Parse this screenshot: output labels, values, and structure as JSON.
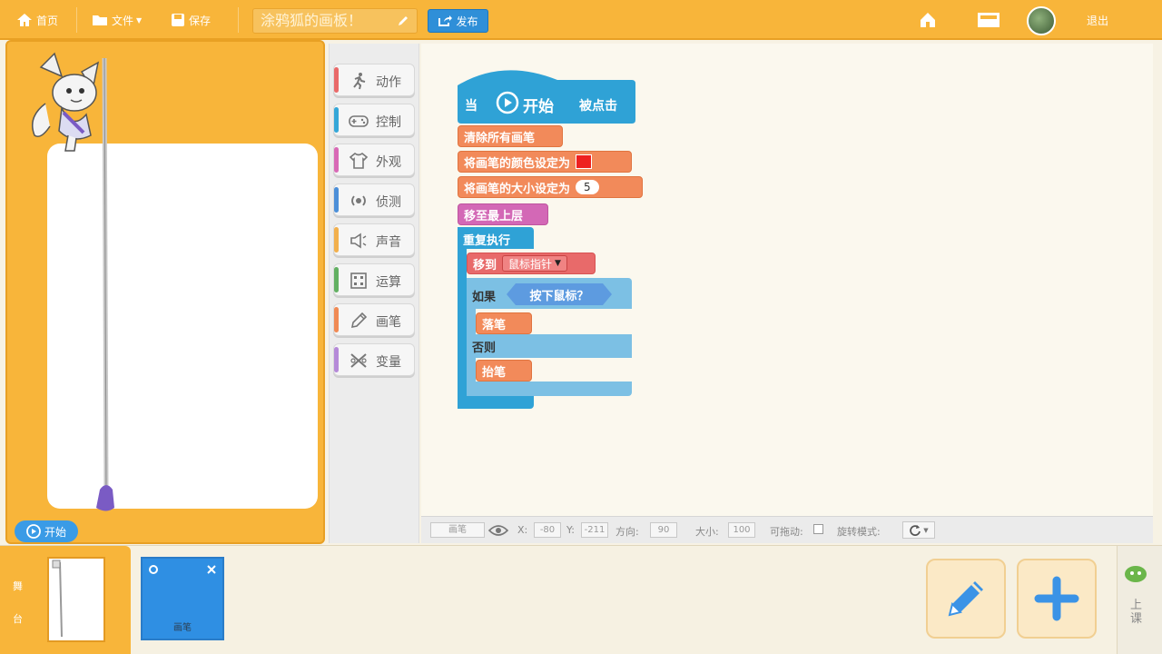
{
  "topbar": {
    "home": "首页",
    "file": "文件",
    "save": "保存",
    "project_title": "涂鸦狐的画板！",
    "publish": "发布",
    "exit": "退出"
  },
  "stage": {
    "start_label": "开始"
  },
  "categories": [
    {
      "label": "动作",
      "icon": "runner-icon",
      "color": "#e96a6a"
    },
    {
      "label": "控制",
      "icon": "gamepad-icon",
      "color": "#35a7d8"
    },
    {
      "label": "外观",
      "icon": "shirt-icon",
      "color": "#d86ab6"
    },
    {
      "label": "侦测",
      "icon": "sensor-icon",
      "color": "#4c8fd8"
    },
    {
      "label": "声音",
      "icon": "speaker-icon",
      "color": "#f2b04d"
    },
    {
      "label": "运算",
      "icon": "calculator-icon",
      "color": "#63b063"
    },
    {
      "label": "画笔",
      "icon": "pencil-icon",
      "color": "#f08a55"
    },
    {
      "label": "变量",
      "icon": "variable-icon",
      "color": "#b58ad8"
    }
  ],
  "script": {
    "hat_when": "当",
    "hat_start": "开始",
    "hat_clicked": "被点击",
    "clear": "清除所有画笔",
    "set_color": "将画笔的颜色设定为",
    "set_size": "将画笔的大小设定为",
    "size_value": "5",
    "front": "移至最上层",
    "forever": "重复执行",
    "move_to": "移到",
    "mouse_pointer": "鼠标指针",
    "if": "如果",
    "mouse_down": "按下鼠标？",
    "pen_down": "落笔",
    "else": "否则",
    "pen_up": "抬笔"
  },
  "status": {
    "sprite_name": "画笔",
    "x_label": "X:",
    "x_value": "-80",
    "y_label": "Y:",
    "y_value": "-211",
    "dir_label": "方向:",
    "dir_value": "90",
    "size_label": "大小:",
    "size_value": "100",
    "draggable_label": "可拖动:",
    "rotate_label": "旋转模式:"
  },
  "bottom": {
    "side_tab_1": "舞",
    "side_tab_2": "台",
    "sprite_label": "画笔",
    "right_tab": "上课"
  },
  "colors": {
    "accent": "#f8b53a",
    "pen": "#f28a5a",
    "control": "#2fa2d6",
    "sensing": "#5d9be0"
  }
}
